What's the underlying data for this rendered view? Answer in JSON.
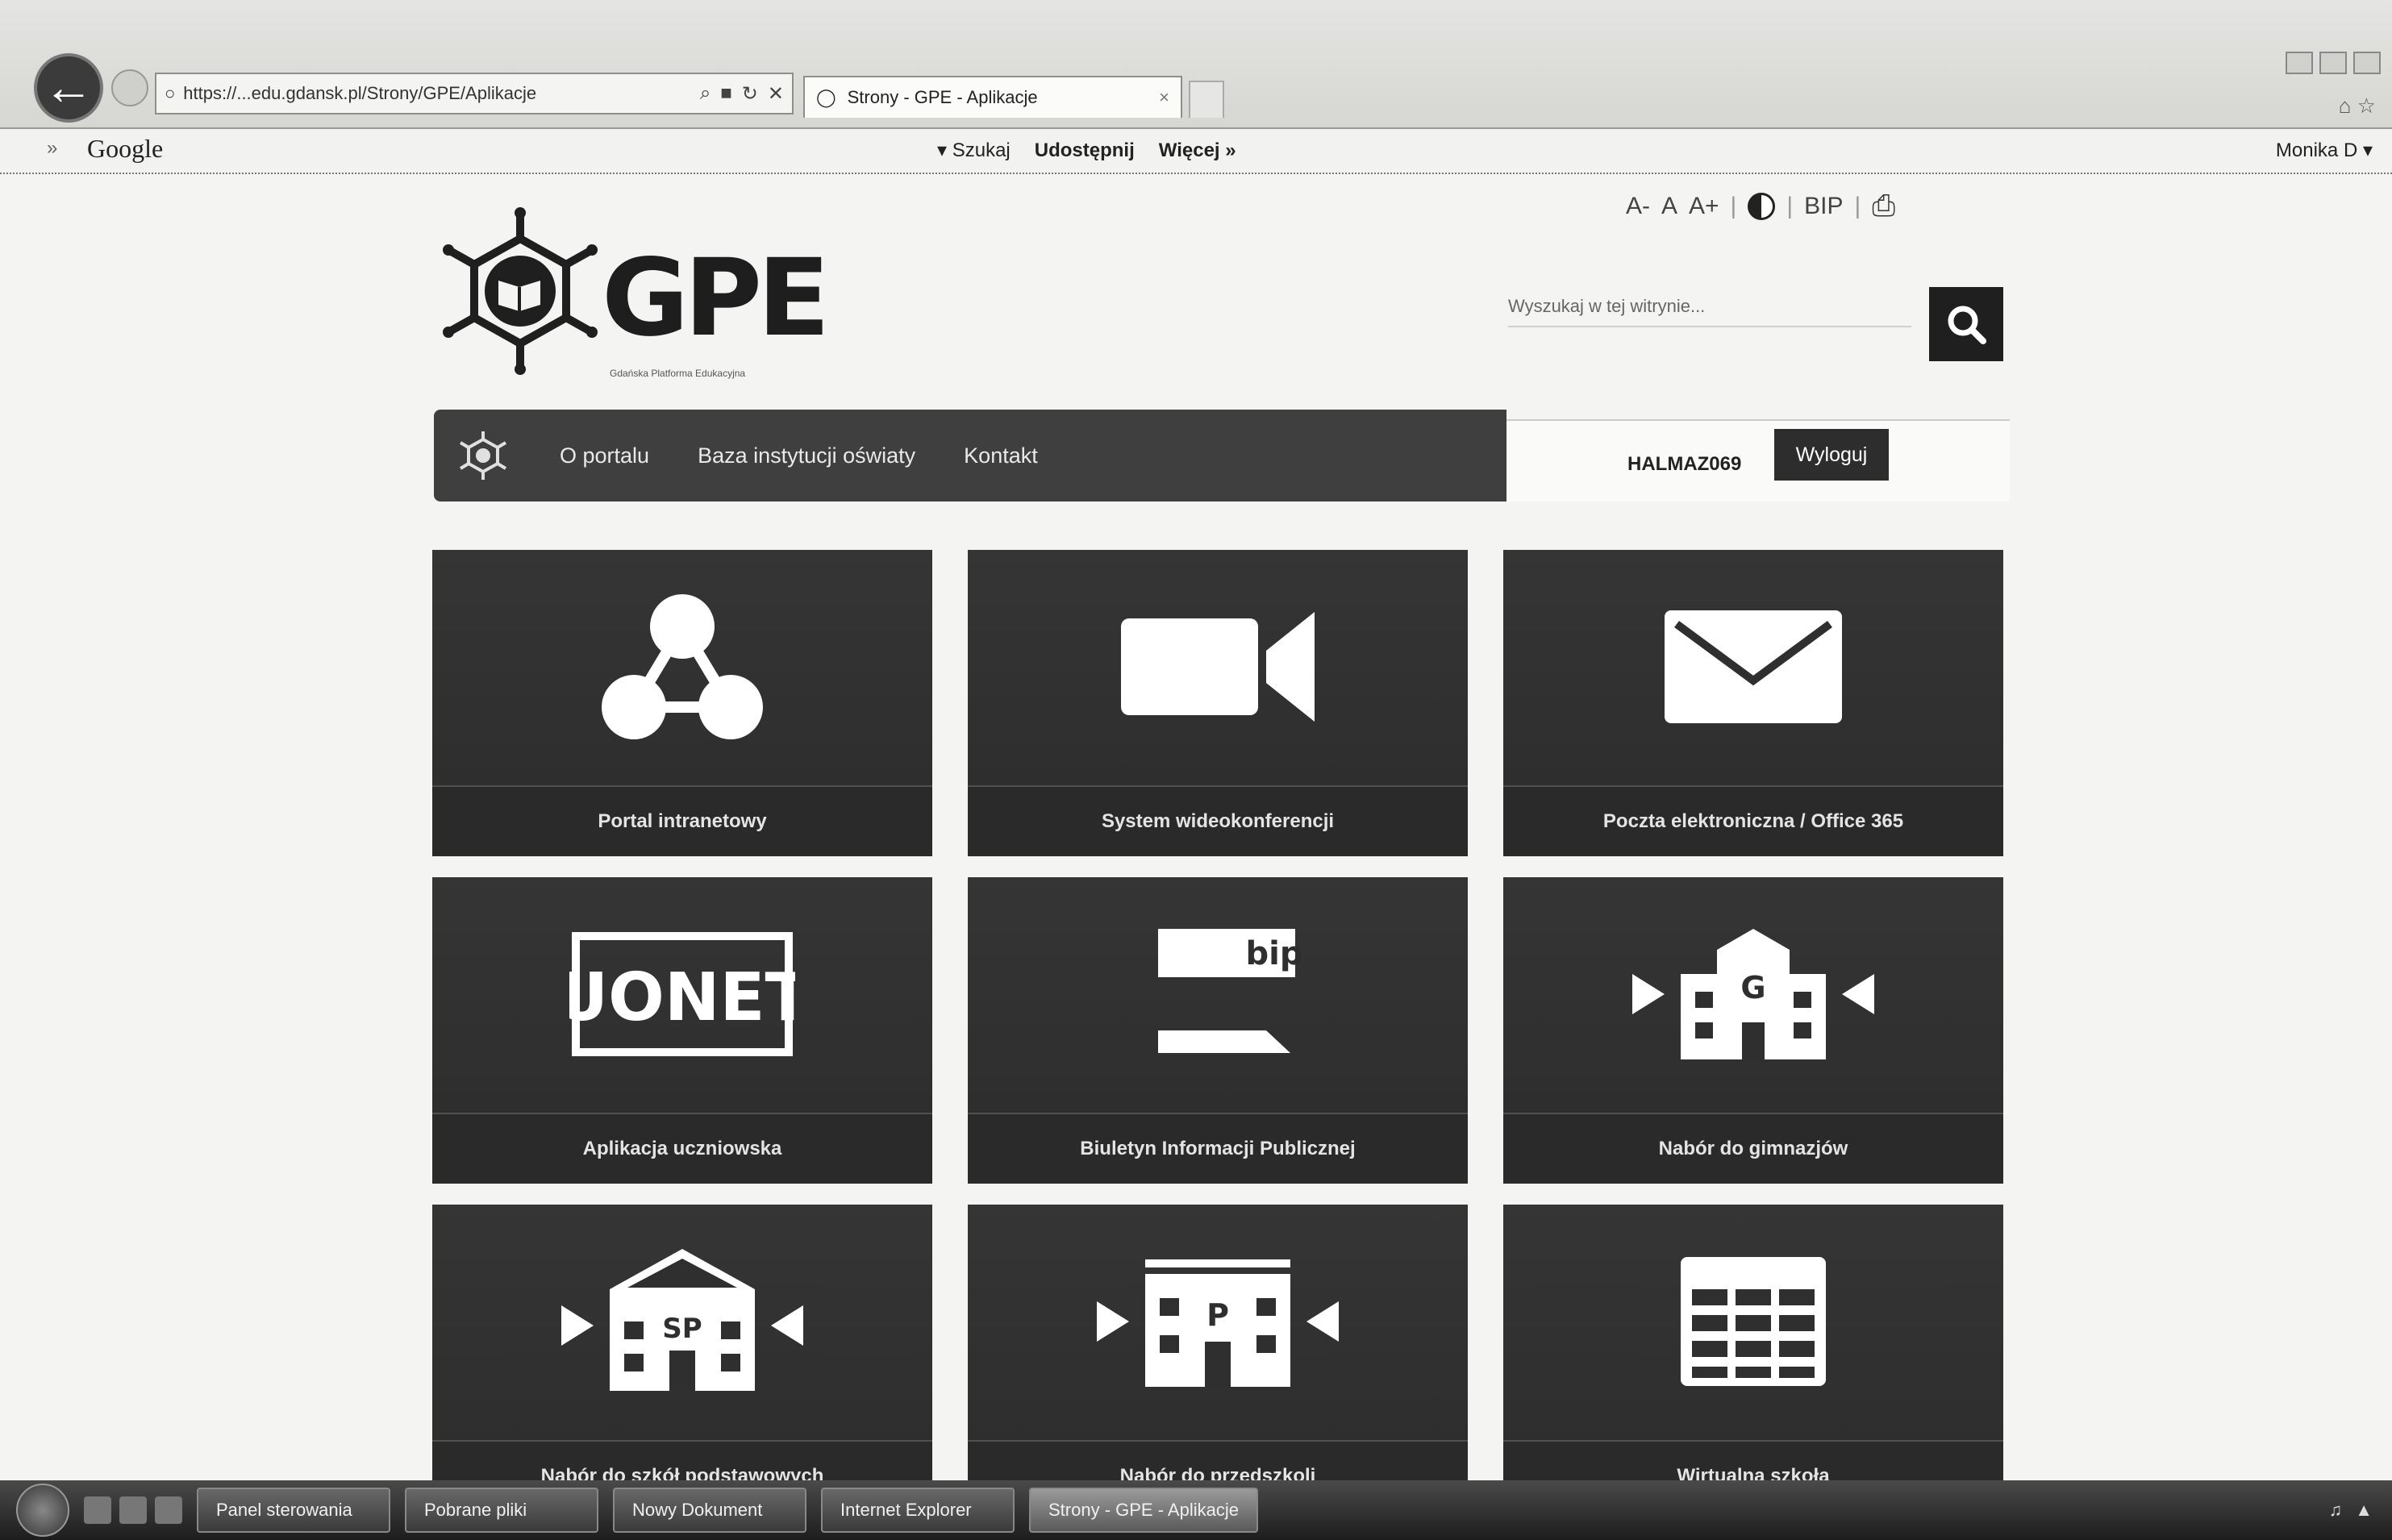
{
  "browser": {
    "address": "https://...edu.gdansk.pl/Strony/GPE/Aplikacje",
    "tab_title": "Strony - GPE - Aplikacje",
    "tab_close": "×"
  },
  "google_bar": {
    "arrow": "»",
    "brand": "Google",
    "share": "Szukaj",
    "udostepnij": "Udostępnij",
    "more": "Więcej »",
    "user": "Monika D ▾"
  },
  "header": {
    "logo_text": "GPE",
    "logo_tagline": "Gdańska Platforma Edukacyjna",
    "font_sizes": [
      "A-",
      "A",
      "A+"
    ],
    "lang": "BIP",
    "search_placeholder": "Wyszukaj w tej witrynie..."
  },
  "nav": {
    "items": [
      "O portalu",
      "Baza instytucji oświaty",
      "Kontakt"
    ]
  },
  "user": {
    "name": "HALMAZ069",
    "logout": "Wyloguj"
  },
  "tiles": [
    {
      "label": "Portal intranetowy",
      "icon": "network-icon"
    },
    {
      "label": "System wideokonferencji",
      "icon": "video-camera-icon"
    },
    {
      "label": "Poczta elektroniczna / Office 365",
      "icon": "envelope-icon"
    },
    {
      "label": "Aplikacja uczniowska",
      "icon": "uonet-icon",
      "icon_text": "UONET"
    },
    {
      "label": "Biuletyn Informacji Publicznej",
      "icon": "bip-icon",
      "icon_text": "bip"
    },
    {
      "label": "Nabór do gimnazjów",
      "icon": "school-g-icon",
      "icon_text": "G"
    },
    {
      "label": "Nabór do szkół podstawowych",
      "icon": "school-sp-icon",
      "icon_text": "SP"
    },
    {
      "label": "Nabór do przedszkoli",
      "icon": "school-p-icon",
      "icon_text": "P"
    },
    {
      "label": "Wirtualna szkoła",
      "icon": "grid-table-icon"
    }
  ],
  "taskbar": {
    "items": [
      "Panel sterowania",
      "Pobrane pliki",
      "Nowy Dokument",
      "Internet Explorer",
      "Strony - GPE - Aplikacje"
    ]
  }
}
